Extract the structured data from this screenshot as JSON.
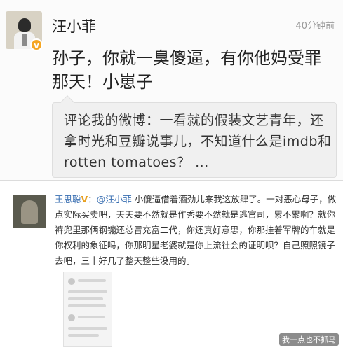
{
  "post": {
    "username": "汪小菲",
    "timestamp": "40分钟前",
    "text": "孙子，你就一臭傻逼，有你他妈受罪那天！小崽子",
    "quote": "评论我的微博：一看就的假装文艺青年，还拿时光和豆瓣说事儿，不知道什么是imdb和rotten tomatoes？ ..."
  },
  "reply": {
    "username": "王思聪",
    "verified_mark": "V",
    "separator": "：",
    "mention": "@汪小菲",
    "text": "  小傻逼借着酒劲儿来我这放肆了。一对恶心母子，做点实际买卖吧，天天要不然就是作秀要不然就是逃官司，累不累啊？就你裤兜里那俩钢镚还总冒充富二代，你还真好意思，你那挂着军牌的车就是你权利的象征吗，你那明星老婆就是你上流社会的证明呗？自己照照镜子去吧，三十好几了整天整些没用的。"
  },
  "watermark": "我一点也不抓马",
  "colors": {
    "link": "#3a6fb2",
    "verified": "#f5a623",
    "timestamp": "#9a9a9a"
  }
}
